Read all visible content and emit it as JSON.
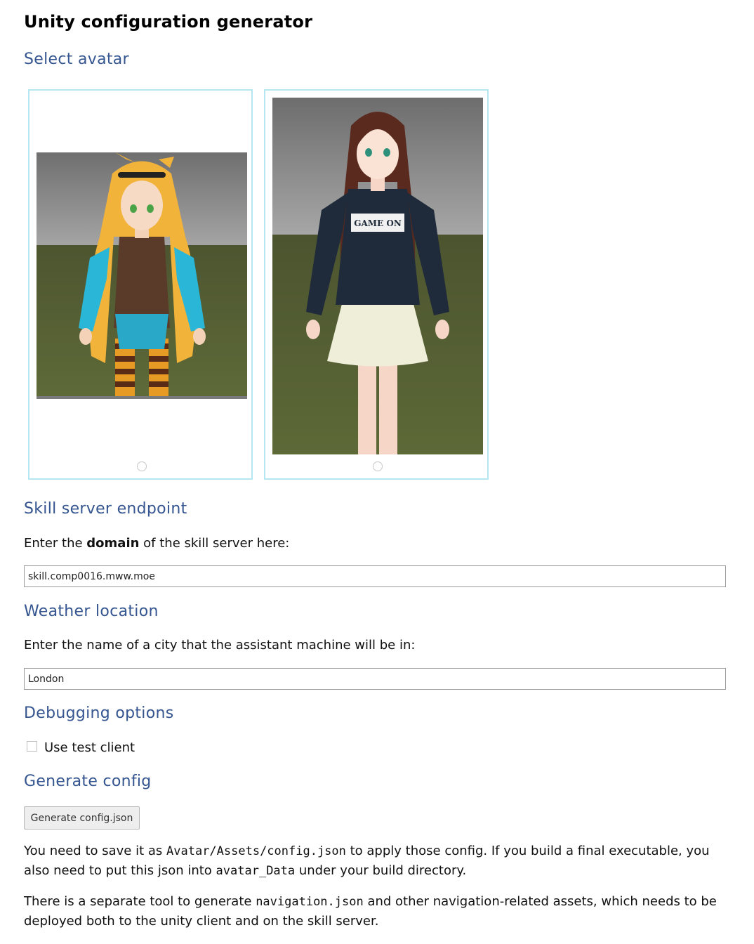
{
  "page_title": "Unity configuration generator",
  "avatar_section": {
    "heading": "Select avatar",
    "avatars": [
      {
        "icon": "anime-girl-blonde-avatar-icon"
      },
      {
        "icon": "anime-girl-hoodie-avatar-icon",
        "shirt_text": "GAME ON"
      }
    ]
  },
  "skill_server": {
    "heading": "Skill server endpoint",
    "prompt_before": "Enter the ",
    "prompt_bold": "domain",
    "prompt_after": " of the skill server here:",
    "value": "skill.comp0016.mww.moe"
  },
  "weather": {
    "heading": "Weather location",
    "prompt": "Enter the name of a city that the assistant machine will be in:",
    "value": "London"
  },
  "debugging": {
    "heading": "Debugging options",
    "checkbox_label": "Use test client"
  },
  "generate": {
    "heading": "Generate config",
    "button_label": "Generate config.json",
    "note1_a": "You need to save it as ",
    "note1_code1": "Avatar/Assets/config.json",
    "note1_b": " to apply those config. If you build a final executable, you also need to put this json into ",
    "note1_code2": "avatar_Data",
    "note1_c": " under your build directory.",
    "note2_a": "There is a separate tool to generate ",
    "note2_code": "navigation.json",
    "note2_b": " and other navigation-related assets, which needs to be deployed both to the unity client and on the skill server."
  }
}
